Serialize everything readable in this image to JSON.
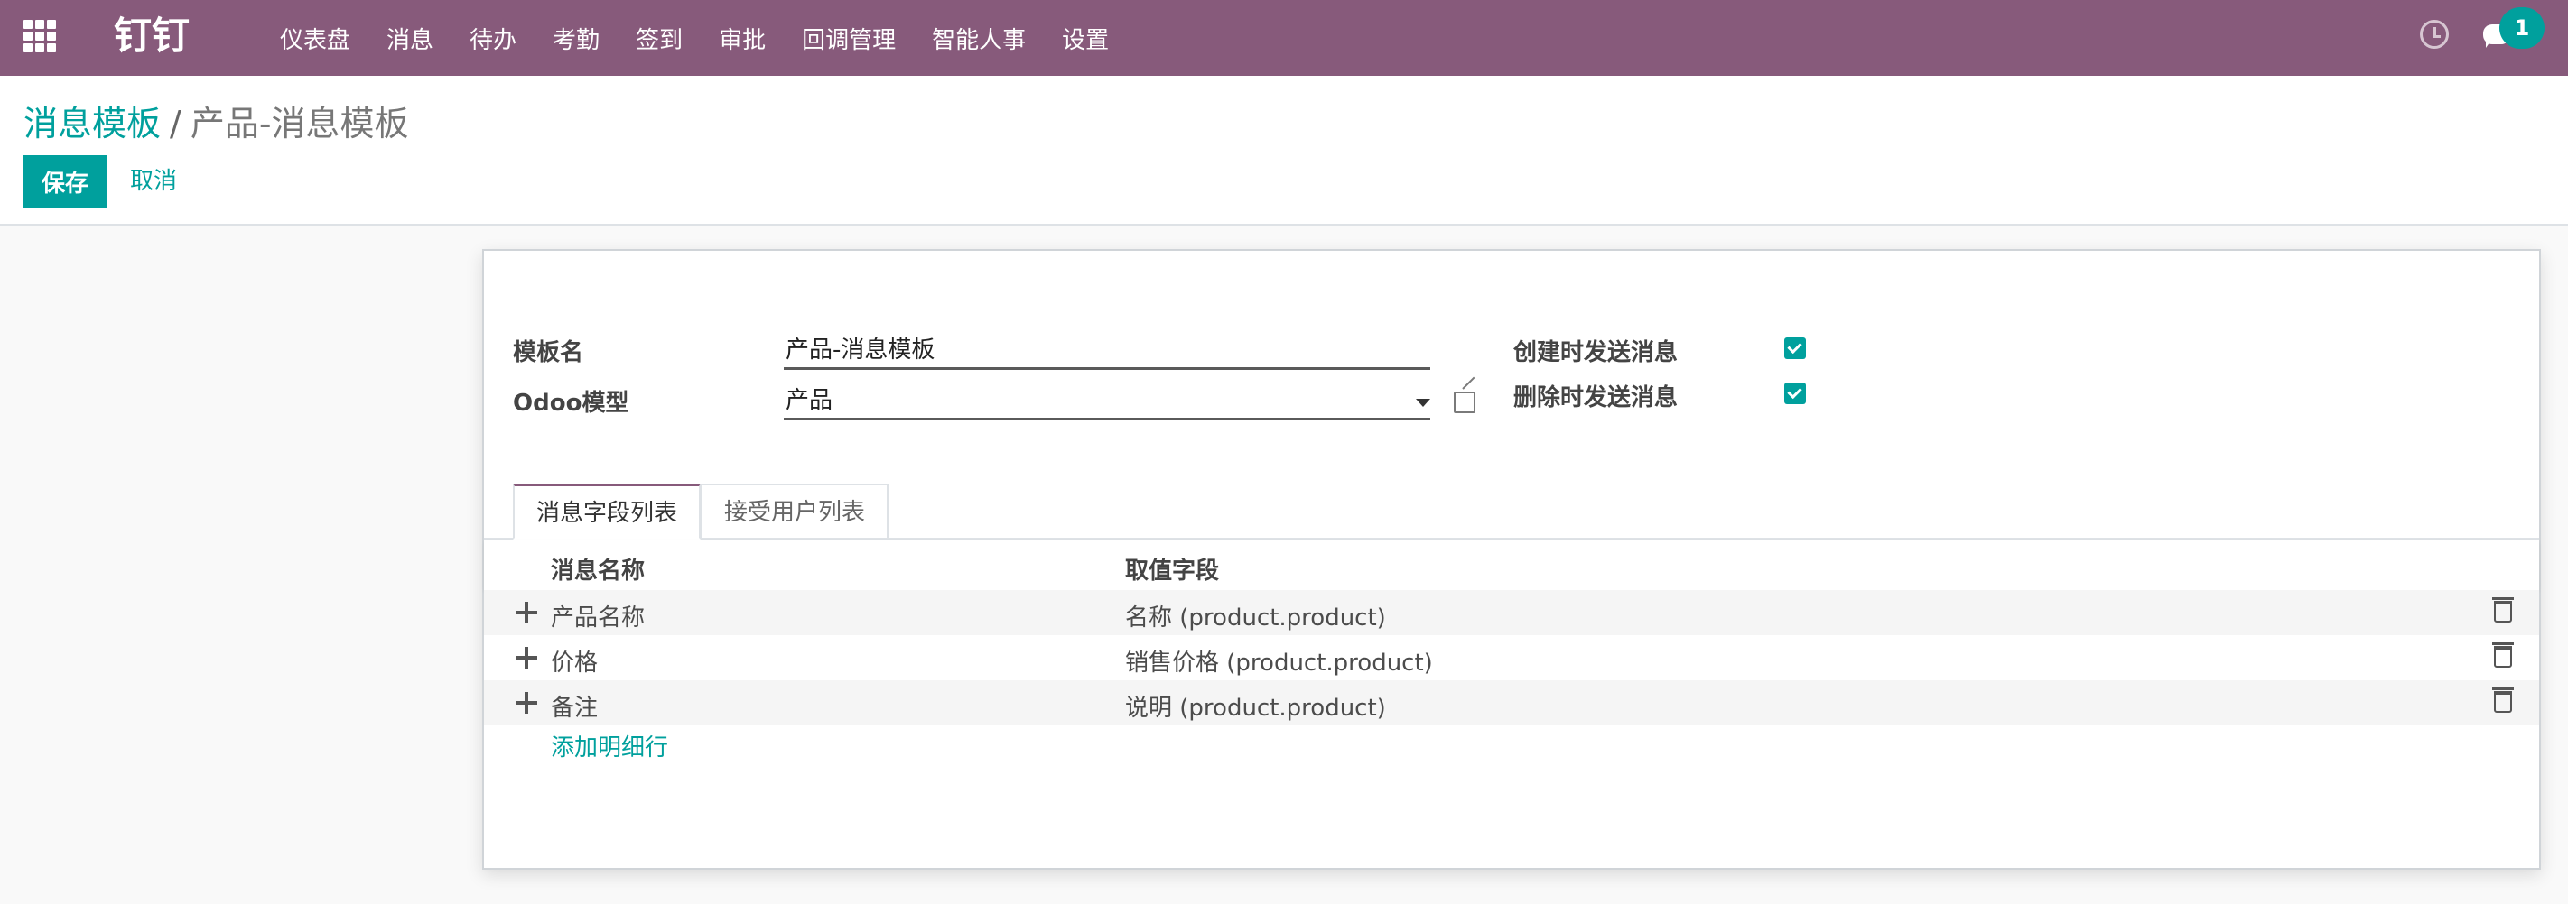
{
  "navbar": {
    "brand": "钉钉",
    "menu": [
      "仪表盘",
      "消息",
      "待办",
      "考勤",
      "签到",
      "审批",
      "回调管理",
      "智能人事",
      "设置"
    ],
    "chat_badge": "1"
  },
  "breadcrumb": {
    "parent": "消息模板",
    "separator": "/",
    "current": "产品-消息模板"
  },
  "buttons": {
    "save": "保存",
    "cancel": "取消"
  },
  "form": {
    "template_name_label": "模板名",
    "template_name_value": "产品-消息模板",
    "odoo_model_label": "Odoo模型",
    "odoo_model_value": "产品",
    "send_on_create_label": "创建时发送消息",
    "send_on_create_checked": true,
    "send_on_delete_label": "删除时发送消息",
    "send_on_delete_checked": true
  },
  "tabs": [
    "消息字段列表",
    "接受用户列表"
  ],
  "table": {
    "headers": [
      "消息名称",
      "取值字段"
    ],
    "rows": [
      {
        "name": "产品名称",
        "field": "名称 (product.product)"
      },
      {
        "name": "价格",
        "field": "销售价格 (product.product)"
      },
      {
        "name": "备注",
        "field": "说明 (product.product)"
      }
    ],
    "add_line": "添加明细行"
  },
  "colors": {
    "navbar": "#875a7b",
    "primary": "#00a09d"
  }
}
